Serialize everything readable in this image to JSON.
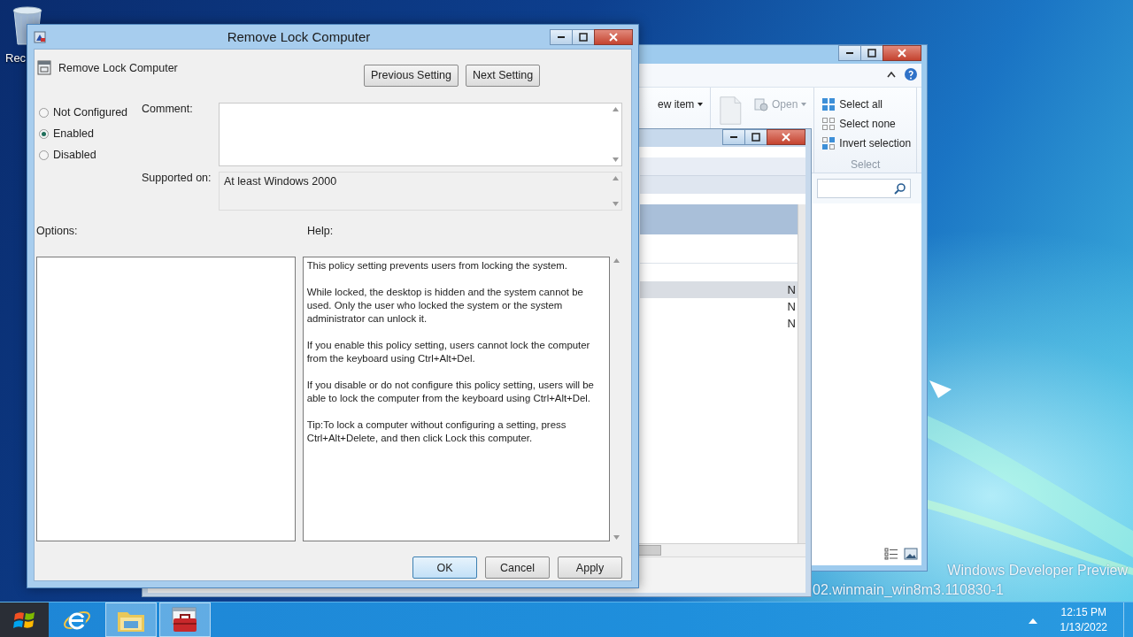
{
  "desktop": {
    "icons": [
      {
        "label": "Rec"
      }
    ],
    "watermark": [
      "Windows Developer Preview",
      "02.winmain_win8m3.110830-1"
    ]
  },
  "explorer": {
    "ribbon_items": [
      {
        "label": "ew item",
        "dropdown": true,
        "disabled": false
      },
      {
        "label": "Open",
        "dropdown": true,
        "disabled": true
      }
    ],
    "select_group": {
      "items": [
        "Select all",
        "Select none",
        "Invert selection"
      ],
      "title": "Select"
    }
  },
  "background_window": {
    "rows": [
      {
        "cell": "N",
        "selected": true
      },
      {
        "cell": "N",
        "selected": false
      },
      {
        "cell": "N",
        "selected": false
      }
    ]
  },
  "dialog": {
    "title": "Remove Lock Computer",
    "policy_name": "Remove Lock Computer",
    "nav_buttons": [
      "Previous Setting",
      "Next Setting"
    ],
    "options": [
      {
        "label": "Not Configured",
        "selected": false
      },
      {
        "label": "Enabled",
        "selected": true
      },
      {
        "label": "Disabled",
        "selected": false
      }
    ],
    "comment_label": "Comment:",
    "supported_label": "Supported on:",
    "supported_value": "At least Windows 2000",
    "options_label": "Options:",
    "help_label": "Help:",
    "help_paragraphs": [
      "This policy setting prevents users from locking the system.",
      "While locked, the desktop is hidden and the system cannot be used. Only the user who locked the system or the system administrator can unlock it.",
      "If you enable this policy setting, users cannot lock the computer from the keyboard using Ctrl+Alt+Del.",
      "If you disable or do not configure this policy setting, users will be able to lock the computer from the keyboard using Ctrl+Alt+Del.",
      "Tip:To lock a computer without configuring a setting, press Ctrl+Alt+Delete, and then click Lock this computer."
    ],
    "buttons": [
      {
        "label": "OK",
        "kind": "default"
      },
      {
        "label": "Cancel",
        "kind": "normal"
      },
      {
        "label": "Apply",
        "kind": "normal"
      }
    ]
  },
  "taskbar": {
    "apps": [
      {
        "kind": "browser",
        "active": false
      },
      {
        "kind": "files",
        "active": true
      },
      {
        "kind": "toolbox",
        "active": true
      }
    ],
    "time": "12:15 PM",
    "date": "1/13/2022"
  }
}
